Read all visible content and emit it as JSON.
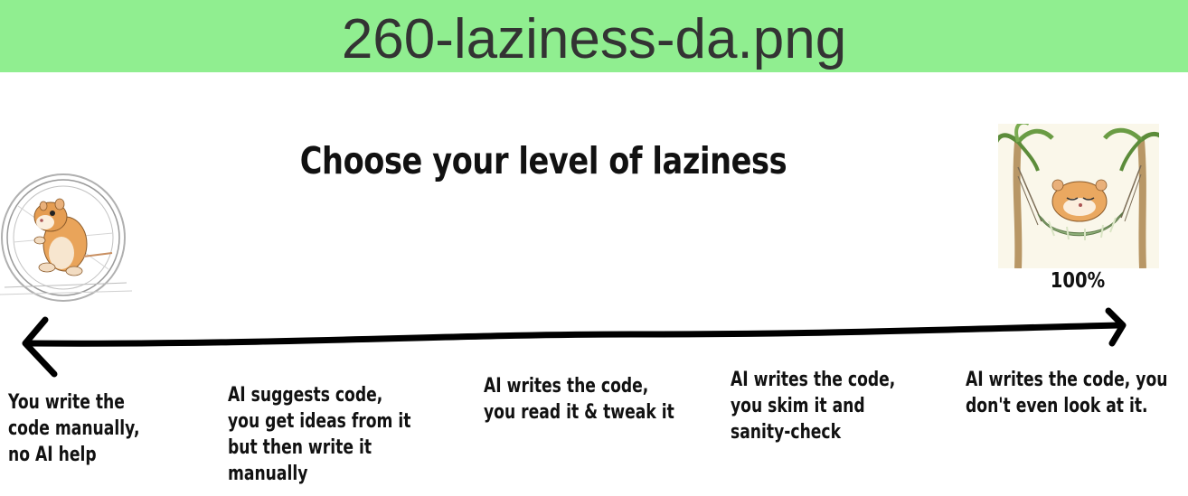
{
  "banner": {
    "filename": "260-laziness-da.png",
    "color": "#90ee90"
  },
  "title": "Choose your level of laziness",
  "scale_end_label": "100%",
  "levels": [
    {
      "lines": [
        "You write the",
        "code manually,",
        "no AI help"
      ]
    },
    {
      "lines": [
        "AI suggests code,",
        "you get ideas from it",
        "but then write it",
        "manually"
      ]
    },
    {
      "lines": [
        "AI writes the code,",
        "you read it & tweak it"
      ]
    },
    {
      "lines": [
        "AI writes the code,",
        "you skim it and",
        "sanity-check"
      ]
    },
    {
      "lines": [
        "AI writes the code, you",
        "don't even look at it."
      ]
    }
  ],
  "icons": {
    "left": "hamster-running-wheel-icon",
    "right": "hamster-resting-hammock-icon",
    "axis": "double-headed-arrow-icon"
  }
}
